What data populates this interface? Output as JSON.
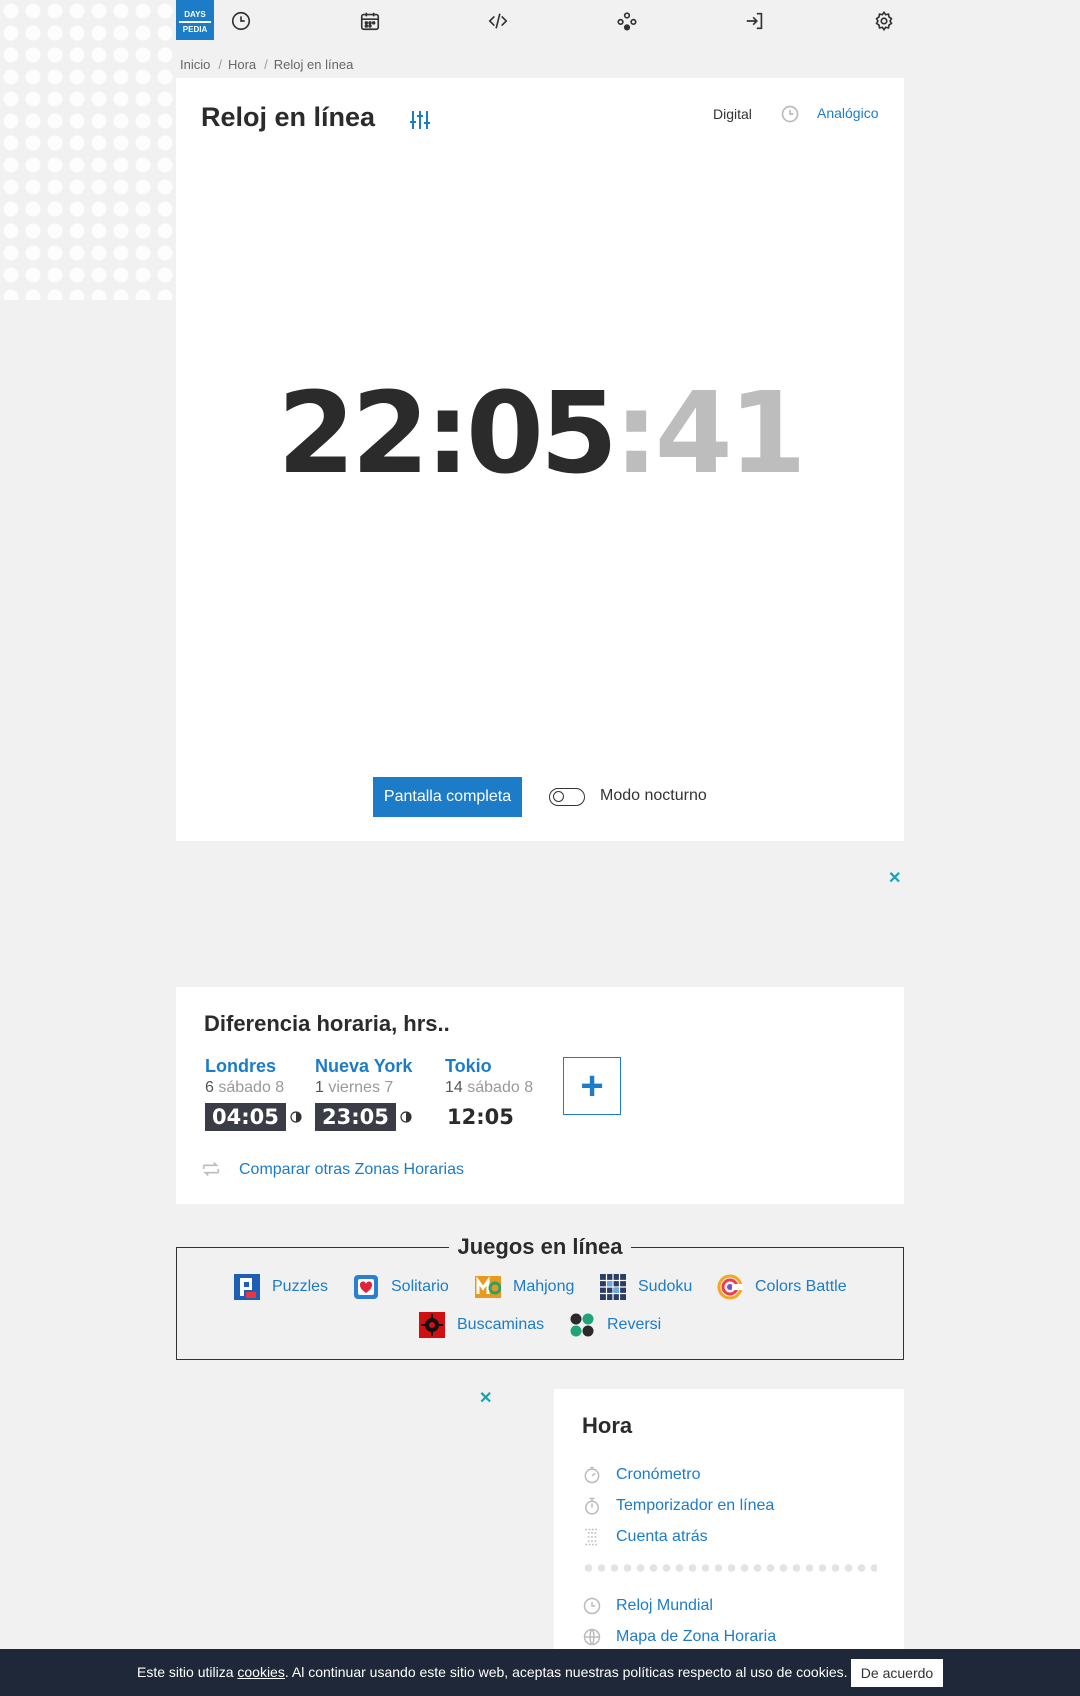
{
  "logo": {
    "line1": "DAYS",
    "line2": "PEDIA"
  },
  "nav": {
    "icons": [
      "clock-icon",
      "calendar-icon",
      "code-icon",
      "games-icon",
      "login-icon",
      "gear-icon"
    ]
  },
  "breadcrumb": [
    "Inicio",
    "Hora",
    "Reloj en línea"
  ],
  "clock_page": {
    "title": "Reloj en línea",
    "mode_digital": "Digital",
    "mode_analog": "Analógico",
    "time_hm": "22:05",
    "time_sec": ":41",
    "fullscreen_label": "Pantalla completa",
    "night_mode_label": "Modo nocturno",
    "night_mode_on": false
  },
  "ad": {
    "close_glyph": "✕"
  },
  "time_diff": {
    "title": "Diferencia horaria, hrs..",
    "cities": [
      {
        "name": "Londres",
        "diff": "6",
        "day": "sábado 8",
        "time": "04:05",
        "night": true
      },
      {
        "name": "Nueva York",
        "diff": "1",
        "day": "viernes 7",
        "time": "23:05",
        "night": true
      },
      {
        "name": "Tokio",
        "diff": "14",
        "day": "sábado 8",
        "time": "12:05",
        "night": false
      }
    ],
    "add_glyph": "+",
    "compare_label": "Comparar otras Zonas Horarias"
  },
  "games": {
    "title": "Juegos en línea",
    "items": [
      {
        "label": "Puzzles",
        "icon": "puzzles-icon",
        "color": "#1c5fb5"
      },
      {
        "label": "Solitario",
        "icon": "solitaire-icon",
        "color": "#2b7fd0"
      },
      {
        "label": "Mahjong",
        "icon": "mahjong-icon",
        "color": "#e89a1e"
      },
      {
        "label": "Sudoku",
        "icon": "sudoku-icon",
        "color": "#2a3d66"
      },
      {
        "label": "Colors Battle",
        "icon": "colors-battle-icon",
        "color": "#e8434c"
      },
      {
        "label": "Buscaminas",
        "icon": "minesweeper-icon",
        "color": "#d01010"
      },
      {
        "label": "Reversi",
        "icon": "reversi-icon",
        "color": "#1fa37a"
      }
    ]
  },
  "hora": {
    "title": "Hora",
    "items": [
      {
        "label": "Cronómetro",
        "icon": "stopwatch-icon"
      },
      {
        "label": "Temporizador en línea",
        "icon": "timer-icon"
      },
      {
        "label": "Cuenta atrás",
        "icon": "countdown-icon"
      },
      {
        "label": "Reloj Mundial",
        "icon": "world-clock-icon"
      },
      {
        "label": "Mapa de Zona Horaria",
        "icon": "globe-icon"
      }
    ]
  },
  "cookie": {
    "text_before": "Este sitio utiliza ",
    "link": "cookies",
    "text_after": ". Al continuar usando este sitio web, aceptas nuestras políticas respecto al uso de cookies.",
    "button": "De acuerdo"
  },
  "colors": {
    "accent": "#1c7cc7",
    "dark": "#2b2b2b",
    "cookie_bg": "#1e2838",
    "ad_close": "#17a2b8"
  }
}
